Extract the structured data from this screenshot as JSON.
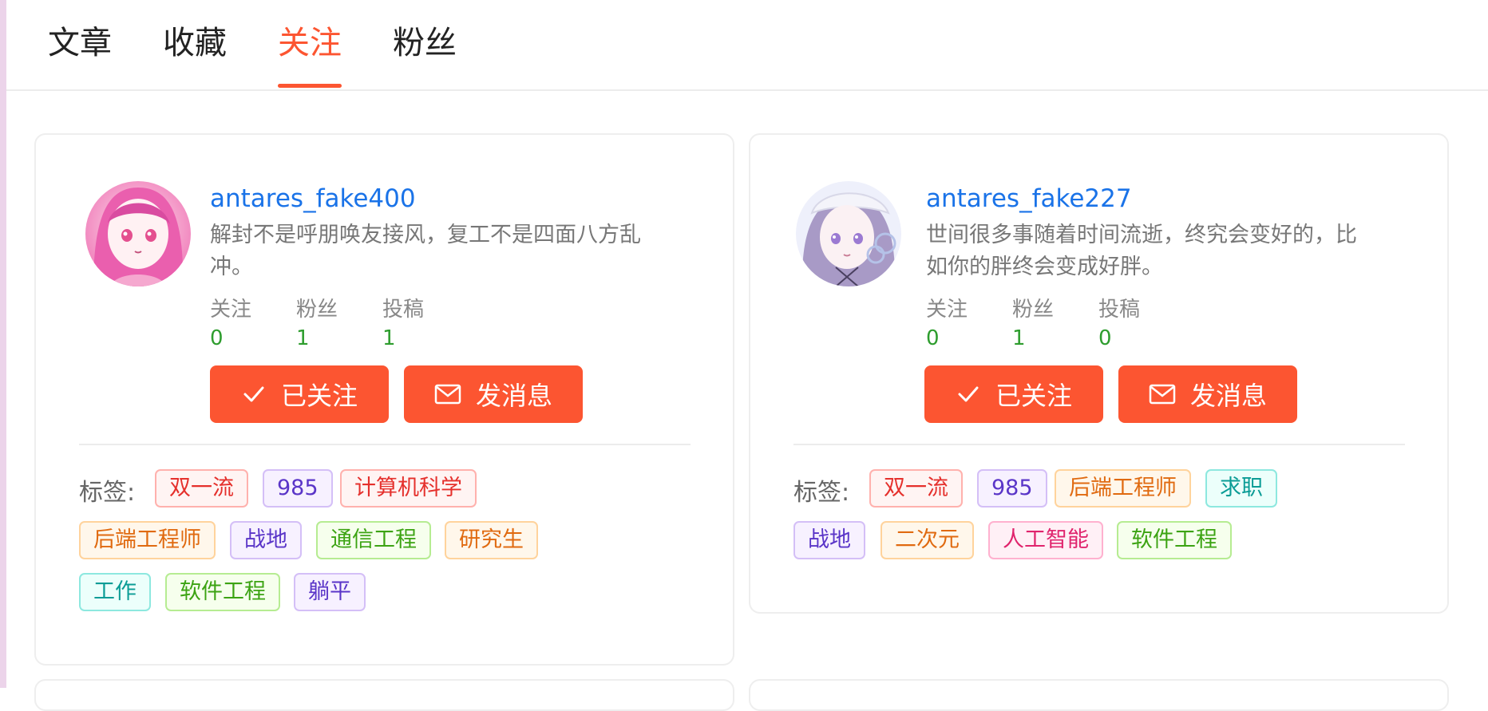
{
  "tabs": [
    {
      "label": "文章"
    },
    {
      "label": "收藏"
    },
    {
      "label": "关注"
    },
    {
      "label": "粉丝"
    }
  ],
  "active_tab": "关注",
  "accent_color": "#fc5531",
  "tags_label": "标签:",
  "cards": [
    {
      "username": "antares_fake400",
      "bio": "解封不是呼朋唤友接风，复工不是四面八方乱冲。",
      "stats": [
        {
          "label": "关注",
          "value": "0"
        },
        {
          "label": "粉丝",
          "value": "1"
        },
        {
          "label": "投稿",
          "value": "1"
        }
      ],
      "follow_button": "已关注",
      "message_button": "发消息",
      "tags": [
        "双一流",
        "985",
        "计算机科学",
        "后端工程师",
        "战地",
        "通信工程",
        "研究生",
        "工作",
        "软件工程",
        "躺平"
      ]
    },
    {
      "username": "antares_fake227",
      "bio": "世间很多事随着时间流逝，终究会变好的，比如你的胖终会变成好胖。",
      "stats": [
        {
          "label": "关注",
          "value": "0"
        },
        {
          "label": "粉丝",
          "value": "1"
        },
        {
          "label": "投稿",
          "value": "0"
        }
      ],
      "follow_button": "已关注",
      "message_button": "发消息",
      "tags": [
        "双一流",
        "985",
        "后端工程师",
        "求职",
        "战地",
        "二次元",
        "人工智能",
        "软件工程"
      ]
    }
  ]
}
